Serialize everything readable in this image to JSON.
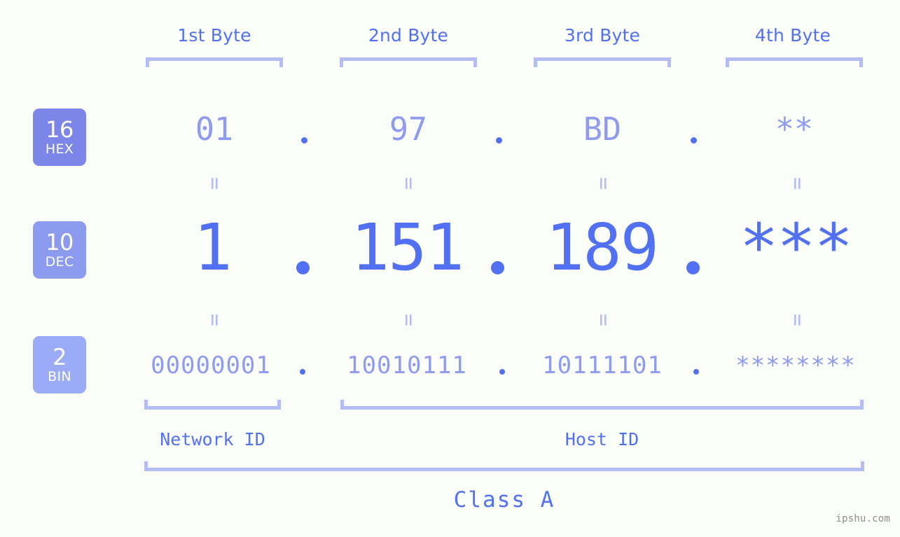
{
  "palette": {
    "background": "#fbfdf8",
    "accent_strong": "#5271f2",
    "accent_mid": "#8e9bf0",
    "accent_light": "#b4bcf7",
    "badge_hex": "#7b86e8",
    "badge_dec": "#8d9bef",
    "badge_bin": "#9cabf5",
    "watermark": "#8e8e8e"
  },
  "headers": [
    {
      "label": "1st Byte"
    },
    {
      "label": "2nd Byte"
    },
    {
      "label": "3rd Byte"
    },
    {
      "label": "4th Byte"
    }
  ],
  "bases": [
    {
      "number": "16",
      "name": "HEX"
    },
    {
      "number": "10",
      "name": "DEC"
    },
    {
      "number": "2",
      "name": "BIN"
    }
  ],
  "rows": {
    "hex": {
      "base_number": "16",
      "base_name": "HEX",
      "bytes": [
        "01",
        "97",
        "BD",
        "**"
      ],
      "separator": "."
    },
    "dec": {
      "base_number": "10",
      "base_name": "DEC",
      "bytes": [
        "1",
        "151",
        "189",
        "***"
      ],
      "separator": "."
    },
    "bin": {
      "base_number": "2",
      "base_name": "BIN",
      "bytes": [
        "00000001",
        "10010111",
        "10111101",
        "********"
      ],
      "separator": "."
    }
  },
  "connectors": {
    "symbol": "=",
    "upper_count": 4,
    "lower_count": 4
  },
  "segments": {
    "network_id": "Network ID",
    "host_id": "Host ID",
    "class": "Class A"
  },
  "watermark": "ipshu.com",
  "chart_data": {
    "type": "table",
    "title": "IP address byte breakdown",
    "categories": [
      "1st Byte",
      "2nd Byte",
      "3rd Byte",
      "4th Byte"
    ],
    "series": [
      {
        "name": "HEX",
        "values": [
          "01",
          "97",
          "BD",
          "**"
        ]
      },
      {
        "name": "DEC",
        "values": [
          "1",
          "151",
          "189",
          "***"
        ]
      },
      {
        "name": "BIN",
        "values": [
          "00000001",
          "10010111",
          "10111101",
          "********"
        ]
      }
    ],
    "annotations": [
      "Network ID",
      "Host ID",
      "Class A"
    ]
  }
}
